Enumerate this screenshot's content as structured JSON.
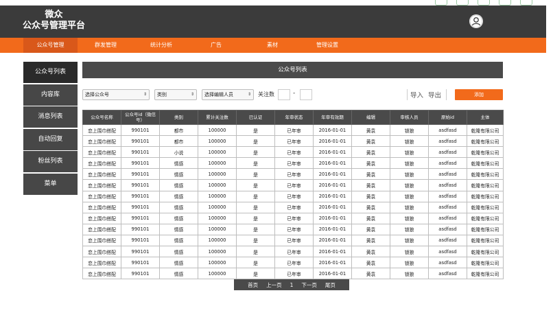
{
  "app": {
    "title_line1": "微众",
    "title_line2": "公众号管理平台"
  },
  "nav": [
    {
      "label": "公众号管理",
      "active": true
    },
    {
      "label": "群发管理"
    },
    {
      "label": "统计分析"
    },
    {
      "label": "广告"
    },
    {
      "label": "素材"
    },
    {
      "label": "管理设置"
    }
  ],
  "sidebar": [
    {
      "label": "公众号列表",
      "active": true
    },
    {
      "label": "内容库"
    },
    {
      "label": "消息列表"
    },
    {
      "label": "自动回复"
    },
    {
      "label": "粉丝列表"
    },
    {
      "label": "菜单"
    }
  ],
  "page_title": "公众号列表",
  "filters": {
    "account_select": "选择公众号",
    "category_select": "类别",
    "editor_select": "选择编辑人员",
    "followers_label": "关注数",
    "range_dash": "-",
    "import_label": "导入",
    "export_label": "导出",
    "add_label": "添加"
  },
  "table": {
    "headers": [
      "公众号名称",
      "公众号id（微信号）",
      "类别",
      "累计关注数",
      "已认证",
      "年审状态",
      "年审有效期",
      "编辑",
      "审核人员",
      "原始id",
      "主体"
    ],
    "rows": [
      [
        "恋上围巾搭配",
        "990101",
        "都市",
        "100000",
        "是",
        "已年审",
        "2016-01-01",
        "黄袁",
        "锁狼",
        "asdfasd",
        "乾隆有限公司"
      ],
      [
        "恋上围巾搭配",
        "990101",
        "都市",
        "100000",
        "是",
        "已年审",
        "2016-01-01",
        "黄袁",
        "锁狼",
        "asdfasd",
        "乾隆有限公司"
      ],
      [
        "恋上围巾搭配",
        "990101",
        "小说",
        "100000",
        "是",
        "已年审",
        "2016-01-01",
        "黄袁",
        "锁狼",
        "asdfasd",
        "乾隆有限公司"
      ],
      [
        "恋上围巾搭配",
        "990101",
        "情感",
        "100000",
        "是",
        "已年审",
        "2016-01-01",
        "黄袁",
        "锁狼",
        "asdfasd",
        "乾隆有限公司"
      ],
      [
        "恋上围巾搭配",
        "990101",
        "情感",
        "100000",
        "是",
        "已年审",
        "2016-01-01",
        "黄袁",
        "锁狼",
        "asdfasd",
        "乾隆有限公司"
      ],
      [
        "恋上围巾搭配",
        "990101",
        "情感",
        "100000",
        "是",
        "已年审",
        "2016-01-01",
        "黄袁",
        "锁狼",
        "asdfasd",
        "乾隆有限公司"
      ],
      [
        "恋上围巾搭配",
        "990101",
        "情感",
        "100000",
        "是",
        "已年审",
        "2016-01-01",
        "黄袁",
        "锁狼",
        "asdfasd",
        "乾隆有限公司"
      ],
      [
        "恋上围巾搭配",
        "990101",
        "情感",
        "100000",
        "是",
        "已年审",
        "2016-01-01",
        "黄袁",
        "锁狼",
        "asdfasd",
        "乾隆有限公司"
      ],
      [
        "恋上围巾搭配",
        "990101",
        "情感",
        "100000",
        "是",
        "已年审",
        "2016-01-01",
        "黄袁",
        "锁狼",
        "asdfasd",
        "乾隆有限公司"
      ],
      [
        "恋上围巾搭配",
        "990101",
        "情感",
        "100000",
        "是",
        "已年审",
        "2016-01-01",
        "黄袁",
        "锁狼",
        "asdfasd",
        "乾隆有限公司"
      ],
      [
        "恋上围巾搭配",
        "990101",
        "情感",
        "100000",
        "是",
        "已年审",
        "2016-01-01",
        "黄袁",
        "锁狼",
        "asdfasd",
        "乾隆有限公司"
      ],
      [
        "恋上围巾搭配",
        "990101",
        "情感",
        "100000",
        "是",
        "已年审",
        "2016-01-01",
        "黄袁",
        "锁狼",
        "asdfasd",
        "乾隆有限公司"
      ],
      [
        "恋上围巾搭配",
        "990101",
        "情感",
        "100000",
        "是",
        "已年审",
        "2016-01-01",
        "黄袁",
        "锁狼",
        "asdfasd",
        "乾隆有限公司"
      ],
      [
        "恋上围巾搭配",
        "990101",
        "情感",
        "100000",
        "是",
        "已年审",
        "2016-01-01",
        "黄袁",
        "锁狼",
        "asdfasd",
        "乾隆有限公司"
      ]
    ]
  },
  "pagination": {
    "first": "首页",
    "prev": "上一页",
    "current": "1",
    "next": "下一页",
    "last": "尾页"
  },
  "icons": {
    "avatar": "user-avatar-icon",
    "select_arrow": "updown-arrow-icon"
  },
  "colors": {
    "header_bg": "#3b3b3b",
    "accent": "#f26a1b",
    "sidebar_bg": "#474747",
    "sidebar_active": "#2a2a2a",
    "table_header": "#4a4a4a"
  }
}
